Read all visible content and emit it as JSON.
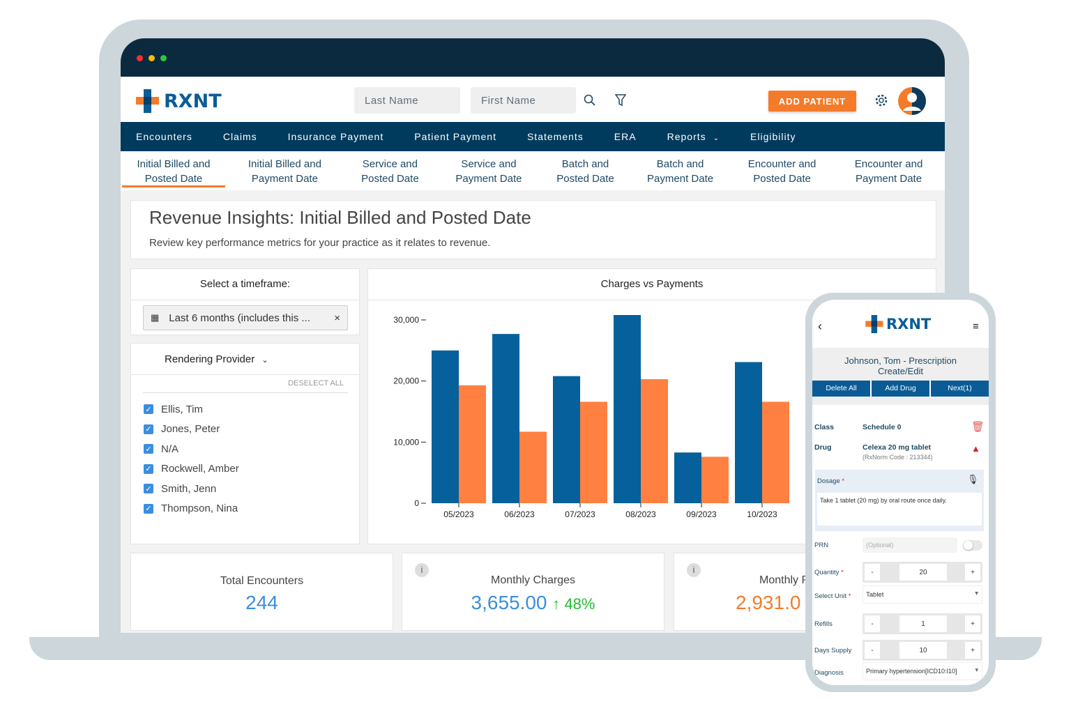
{
  "brand": {
    "name": "RXNT",
    "orange": "#f47b2a",
    "blue": "#0b5c96",
    "navy": "#003a5d"
  },
  "header": {
    "last_name_placeholder": "Last Name",
    "first_name_placeholder": "First Name",
    "add_patient": "ADD PATIENT"
  },
  "nav": [
    "Encounters",
    "Claims",
    "Insurance Payment",
    "Patient Payment",
    "Statements",
    "ERA",
    "Reports",
    "Eligibility"
  ],
  "subnav": [
    [
      "Initial Billed and",
      "Posted Date"
    ],
    [
      "Initial Billed and",
      "Payment Date"
    ],
    [
      "Service and",
      "Posted Date"
    ],
    [
      "Service and",
      "Payment Date"
    ],
    [
      "Batch and",
      "Posted Date"
    ],
    [
      "Batch and",
      "Payment Date"
    ],
    [
      "Encounter and",
      "Posted Date"
    ],
    [
      "Encounter and",
      "Payment Date"
    ]
  ],
  "page": {
    "title": "Revenue Insights: Initial Billed and Posted Date",
    "subtitle": "Review key performance metrics for your practice as it relates to revenue."
  },
  "timeframe": {
    "label": "Select a timeframe:",
    "value": "Last 6 months (includes this ..."
  },
  "provider": {
    "label": "Rendering Provider",
    "deselect": "DESELECT ALL",
    "items": [
      "Ellis, Tim",
      "Jones, Peter",
      "N/A",
      "Rockwell, Amber",
      "Smith, Jenn",
      "Thompson, Nina"
    ]
  },
  "stats": [
    {
      "label": "Total Encounters",
      "value": "244"
    },
    {
      "label": "Monthly Charges",
      "value": "3,655.00",
      "change": "48%"
    },
    {
      "label": "Monthly Payments",
      "value": "2,931.0"
    }
  ],
  "chart_data": {
    "type": "bar",
    "title": "Charges vs Payments",
    "categories": [
      "05/2023",
      "06/2023",
      "07/2023",
      "08/2023",
      "09/2023",
      "10/2023"
    ],
    "series": [
      {
        "color": "#06609b",
        "values": [
          25000,
          27700,
          20800,
          30800,
          8300,
          23100
        ]
      },
      {
        "color": "#ff8040",
        "values": [
          19300,
          11700,
          16600,
          20300,
          7600,
          16600
        ]
      }
    ],
    "yticks": [
      "0",
      "10,000",
      "20,000",
      "30,000"
    ],
    "ylim": [
      0,
      30000
    ],
    "grid": false
  },
  "phone": {
    "title": "Johnson, Tom - Prescription Create/Edit",
    "buttons": [
      "Delete All",
      "Add Drug",
      "Next(1)"
    ],
    "class_label": "Class",
    "class_value": "Schedule 0",
    "drug_label": "Drug",
    "drug_value": "Celexa 20 mg tablet",
    "rxnorm": "(RxNorm Code : 213344)",
    "dosage_label": "Dosage",
    "dosage_value": "Take 1 tablet (20 mg) by oral route once daily.",
    "prn_label": "PRN",
    "prn_placeholder": "(Optional)",
    "quantity_label": "Quantity",
    "quantity": "20",
    "unit_label": "Select Unit",
    "unit": "Tablet",
    "refills_label": "Refills",
    "refills": "1",
    "days_label": "Days Supply",
    "days": "10",
    "diagnosis_label": "Diagnosis",
    "diagnosis": "Primary hypertension[ICD10:I10]",
    "minus": "-",
    "plus": "+",
    "req": "*"
  }
}
